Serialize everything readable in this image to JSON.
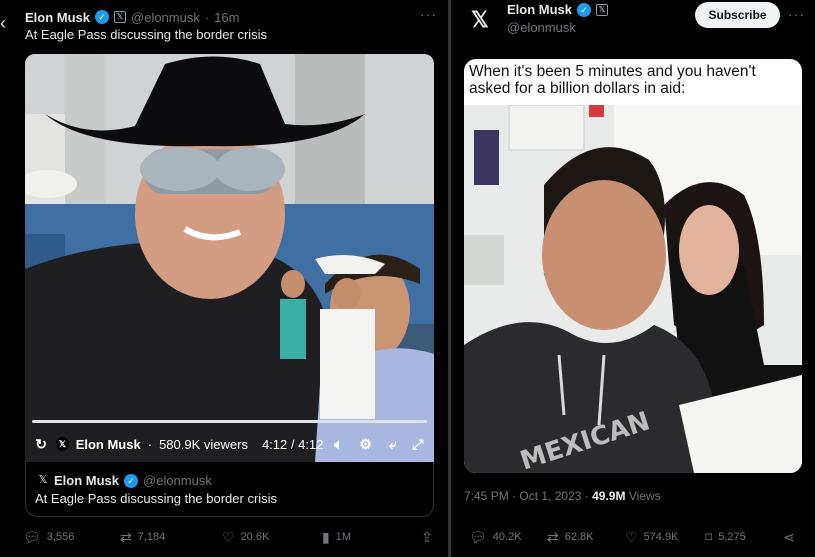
{
  "left_tweet": {
    "author_name": "Elon Musk",
    "handle": "@elonmusk",
    "separator": "·",
    "time": "16m",
    "more": "···",
    "text": "At Eagle Pass discussing the border crisis",
    "video": {
      "channel": "Elon Musk",
      "dot": "·",
      "viewers": "580.9K viewers",
      "elapsed": "4:12 / 4:12",
      "progress_fraction": 1.0
    },
    "quote": {
      "author_name": "Elon Musk",
      "handle": "@elonmusk",
      "text": "At Eagle Pass discussing the border crisis"
    },
    "actions": {
      "replies": "3,556",
      "reposts": "7,184",
      "likes": "20.6K",
      "views": "1M"
    }
  },
  "right_tweet": {
    "author_name": "Elon Musk",
    "handle": "@elonmusk",
    "subscribe_label": "Subscribe",
    "more": "···",
    "meme_caption": "When it's been 5 minutes and you haven't asked for a billion dollars in aid:",
    "meme_shirt_text": "MEXICAN",
    "time": "7:45 PM",
    "dot": "·",
    "date": "Oct 1, 2023",
    "view_count": "49.9M",
    "views_label": "Views",
    "actions": {
      "replies": "40.2K",
      "reposts": "62.8K",
      "likes": "574.9K",
      "bookmarks": "5,275"
    }
  },
  "icons": {
    "back": "chevron-left-icon",
    "verified": "verified-badge-icon",
    "x_logo": "x-logo-icon",
    "replay": "replay-icon",
    "volume": "volume-icon",
    "settings": "gear-icon",
    "minimize": "minimize-icon",
    "fullscreen": "fullscreen-icon",
    "reply": "reply-icon",
    "repost": "repost-icon",
    "like": "heart-icon",
    "views": "views-chart-icon",
    "share": "share-icon",
    "bookmark": "bookmark-icon"
  },
  "colors": {
    "background": "#000000",
    "text": "#e7e9ea",
    "muted": "#71767b",
    "verified_blue": "#1d9bf0",
    "border": "#2f3336"
  }
}
